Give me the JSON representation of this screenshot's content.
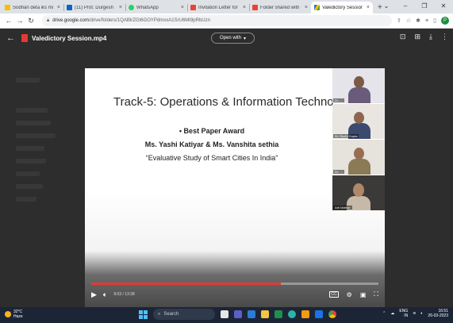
{
  "browser": {
    "tabs": [
      {
        "label": "Sodhan deta iks mun",
        "color": "#fbbc04",
        "active": false
      },
      {
        "label": "(11) Prof. Durgesh B.",
        "color": "#0a66c2",
        "active": false
      },
      {
        "label": "WhatsApp",
        "color": "#25d366",
        "active": false
      },
      {
        "label": "Invitation Letter for S",
        "color": "#ea4335",
        "active": false
      },
      {
        "label": "Folder shared with yo",
        "color": "#ea4335",
        "active": false
      },
      {
        "label": "Valedictory Session -",
        "color": "#1a73e8",
        "active": true
      }
    ],
    "new_tab": "+",
    "url_host": "drive.google.com",
    "url_path": "/drive/folders/1QABlrZGt6GOYPdmxxA1SrU6Mt9pRbUzn",
    "profile_initial": "P"
  },
  "viewer": {
    "file_name": "Valedictory Session.mp4",
    "open_with": "Open with"
  },
  "slide": {
    "title": "Track-5: Operations & Information Techno",
    "bullet": "• Best Paper Award",
    "names": "Ms. Yashi Katiyar & Ms. Vanshita sethia",
    "paper": "“Evaluative Study of Smart Cities In India”"
  },
  "participants": [
    {
      "name": "Dr. ..."
    },
    {
      "name": "Dr. Ruchi Gupta"
    },
    {
      "name": "Dr. ..."
    },
    {
      "name": "Arti Mathur"
    }
  ],
  "player": {
    "time": "9:03 / 13:38",
    "progress_fraction": 0.66,
    "cc": "CC"
  },
  "taskbar": {
    "temperature": "32°C",
    "weather": "Haze",
    "search": "Search",
    "lang": "ENG",
    "lang2": "IN",
    "time": "16:51",
    "date": "26-03-2023"
  }
}
